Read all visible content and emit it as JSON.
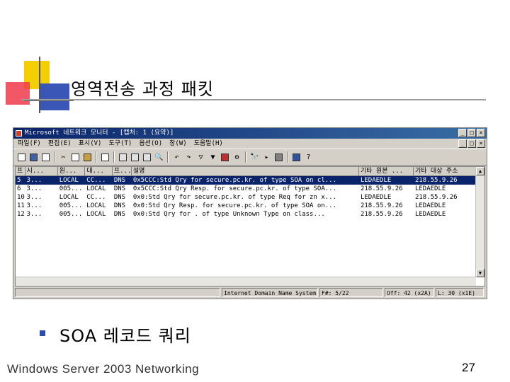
{
  "slide": {
    "title": "영역전송 과정 패킷",
    "bullet": "SOA 레코드 쿼리",
    "footer": "Windows Server 2003 Networking",
    "page_number": "27"
  },
  "window": {
    "title": "Microsoft 네트워크 모니터 - [캡처: 1 (요약)]",
    "menu": [
      "파일(F)",
      "편집(E)",
      "표시(V)",
      "도구(T)",
      "옵션(O)",
      "창(W)",
      "도움말(H)"
    ],
    "toolbar_help": "?"
  },
  "packet_list": {
    "columns": [
      "프",
      "시...",
      "원...",
      "대...",
      "프...",
      "설명",
      "기타 원본 ...",
      "기타 대상 주소"
    ],
    "rows": [
      {
        "frame": "5",
        "time": "3...",
        "src": "LOCAL",
        "dst": "CC...",
        "proto": "DNS",
        "desc": "0x5CCC:Std Qry for secure.pc.kr. of type SOA on cl...",
        "other_src": "LEDAEDLE",
        "other_dst": "218.55.9.26",
        "selected": true
      },
      {
        "frame": "6",
        "time": "3...",
        "src": "005...",
        "dst": "LOCAL",
        "proto": "DNS",
        "desc": "0x5CCC:Std Qry Resp. for secure.pc.kr. of type SOA...",
        "other_src": "218.55.9.26",
        "other_dst": "LEDAEDLE",
        "selected": false
      },
      {
        "frame": "10",
        "time": "3...",
        "src": "LOCAL",
        "dst": "CC...",
        "proto": "DNS",
        "desc": "0x0:Std Qry for secure.pc.kr. of type Req for zn x...",
        "other_src": "LEDAEDLE",
        "other_dst": "218.55.9.26",
        "selected": false
      },
      {
        "frame": "11",
        "time": "3...",
        "src": "005...",
        "dst": "LOCAL",
        "proto": "DNS",
        "desc": "0x0:Std Qry Resp. for secure.pc.kr. of type SOA on...",
        "other_src": "218.55.9.26",
        "other_dst": "LEDAEDLE",
        "selected": false
      },
      {
        "frame": "12",
        "time": "3...",
        "src": "005...",
        "dst": "LOCAL",
        "proto": "DNS",
        "desc": "0x0:Std Qry for . of type Unknown Type on class...",
        "other_src": "218.55.9.26",
        "other_dst": "LEDAEDLE",
        "selected": false
      }
    ]
  },
  "status": {
    "protocol": "Internet Domain Name System Packet",
    "frame": "F#: 5/22",
    "offset": "Off: 42 (x2A)",
    "length": "L: 30 (x1E)"
  }
}
